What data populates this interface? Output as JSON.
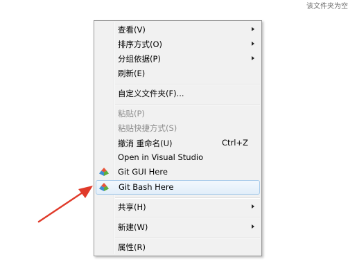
{
  "corner_text": "该文件夹为空",
  "menu": {
    "items": [
      {
        "label": "查看(V)",
        "submenu": true
      },
      {
        "label": "排序方式(O)",
        "submenu": true
      },
      {
        "label": "分组依据(P)",
        "submenu": true
      },
      {
        "label": "刷新(E)"
      },
      {
        "label": "自定义文件夹(F)..."
      },
      {
        "label": "粘贴(P)",
        "disabled": true
      },
      {
        "label": "粘贴快捷方式(S)",
        "disabled": true
      },
      {
        "label": "撤消 重命名(U)",
        "shortcut": "Ctrl+Z"
      },
      {
        "label": "Open in Visual Studio"
      },
      {
        "label": "Git GUI Here",
        "icon": "git-icon"
      },
      {
        "label": "Git Bash Here",
        "icon": "git-icon",
        "highlighted": true
      },
      {
        "label": "共享(H)",
        "submenu": true
      },
      {
        "label": "新建(W)",
        "submenu": true
      },
      {
        "label": "属性(R)"
      }
    ]
  },
  "colors": {
    "git_icon_red": "#e8543a",
    "git_icon_blue": "#3d8ed0",
    "git_icon_green": "#5dae3e",
    "annotation_arrow": "#e03a2a"
  }
}
